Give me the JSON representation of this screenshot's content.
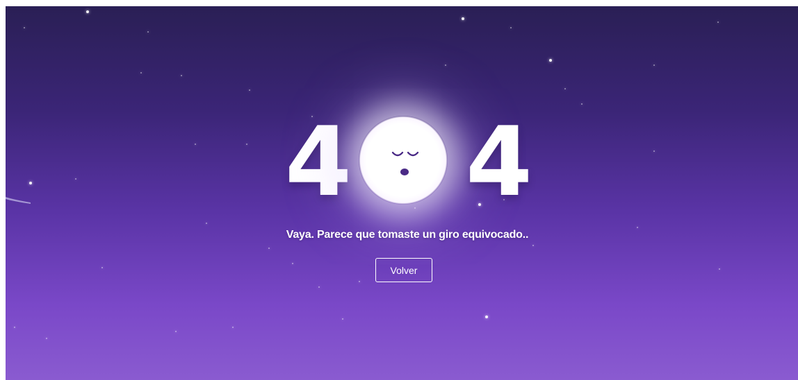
{
  "error_page": {
    "digit_left": "4",
    "digit_right": "4",
    "message": "Vaya. Parece que tomaste un giro equivocado..",
    "back_button_label": "Volver"
  },
  "icons": {
    "moon": "sleeping-moon-icon"
  },
  "colors": {
    "background_top": "#2a1f55",
    "background_bottom": "#8a5bd0",
    "text": "#ffffff",
    "moon_face": "#4a2a86"
  }
}
